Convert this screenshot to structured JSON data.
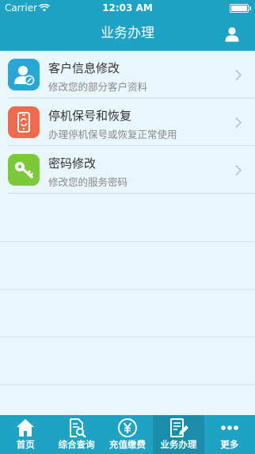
{
  "status": {
    "carrier": "Carrier",
    "time": "12:03 AM"
  },
  "nav": {
    "title": "业务办理"
  },
  "items": [
    {
      "title": "客户信息修改",
      "subtitle": "修改您的部分客户资料",
      "color": "#2aa6d6",
      "icon": "user-edit-icon"
    },
    {
      "title": "停机保号和恢复",
      "subtitle": "办理停机保号或恢复正常使用",
      "color": "#f06b4e",
      "icon": "phone-refresh-icon"
    },
    {
      "title": "密码修改",
      "subtitle": "修改您的服务密码",
      "color": "#7cc93a",
      "icon": "key-icon"
    }
  ],
  "tabs": [
    {
      "label": "首页",
      "icon": "home-icon",
      "active": false
    },
    {
      "label": "综合查询",
      "icon": "document-search-icon",
      "active": false
    },
    {
      "label": "充值缴费",
      "icon": "yen-coin-icon",
      "active": false
    },
    {
      "label": "业务办理",
      "icon": "document-edit-icon",
      "active": true
    },
    {
      "label": "更多",
      "icon": "more-dots-icon",
      "active": false
    }
  ],
  "colors": {
    "accent": "#1fa3c4",
    "background": "#e9f6fb"
  }
}
